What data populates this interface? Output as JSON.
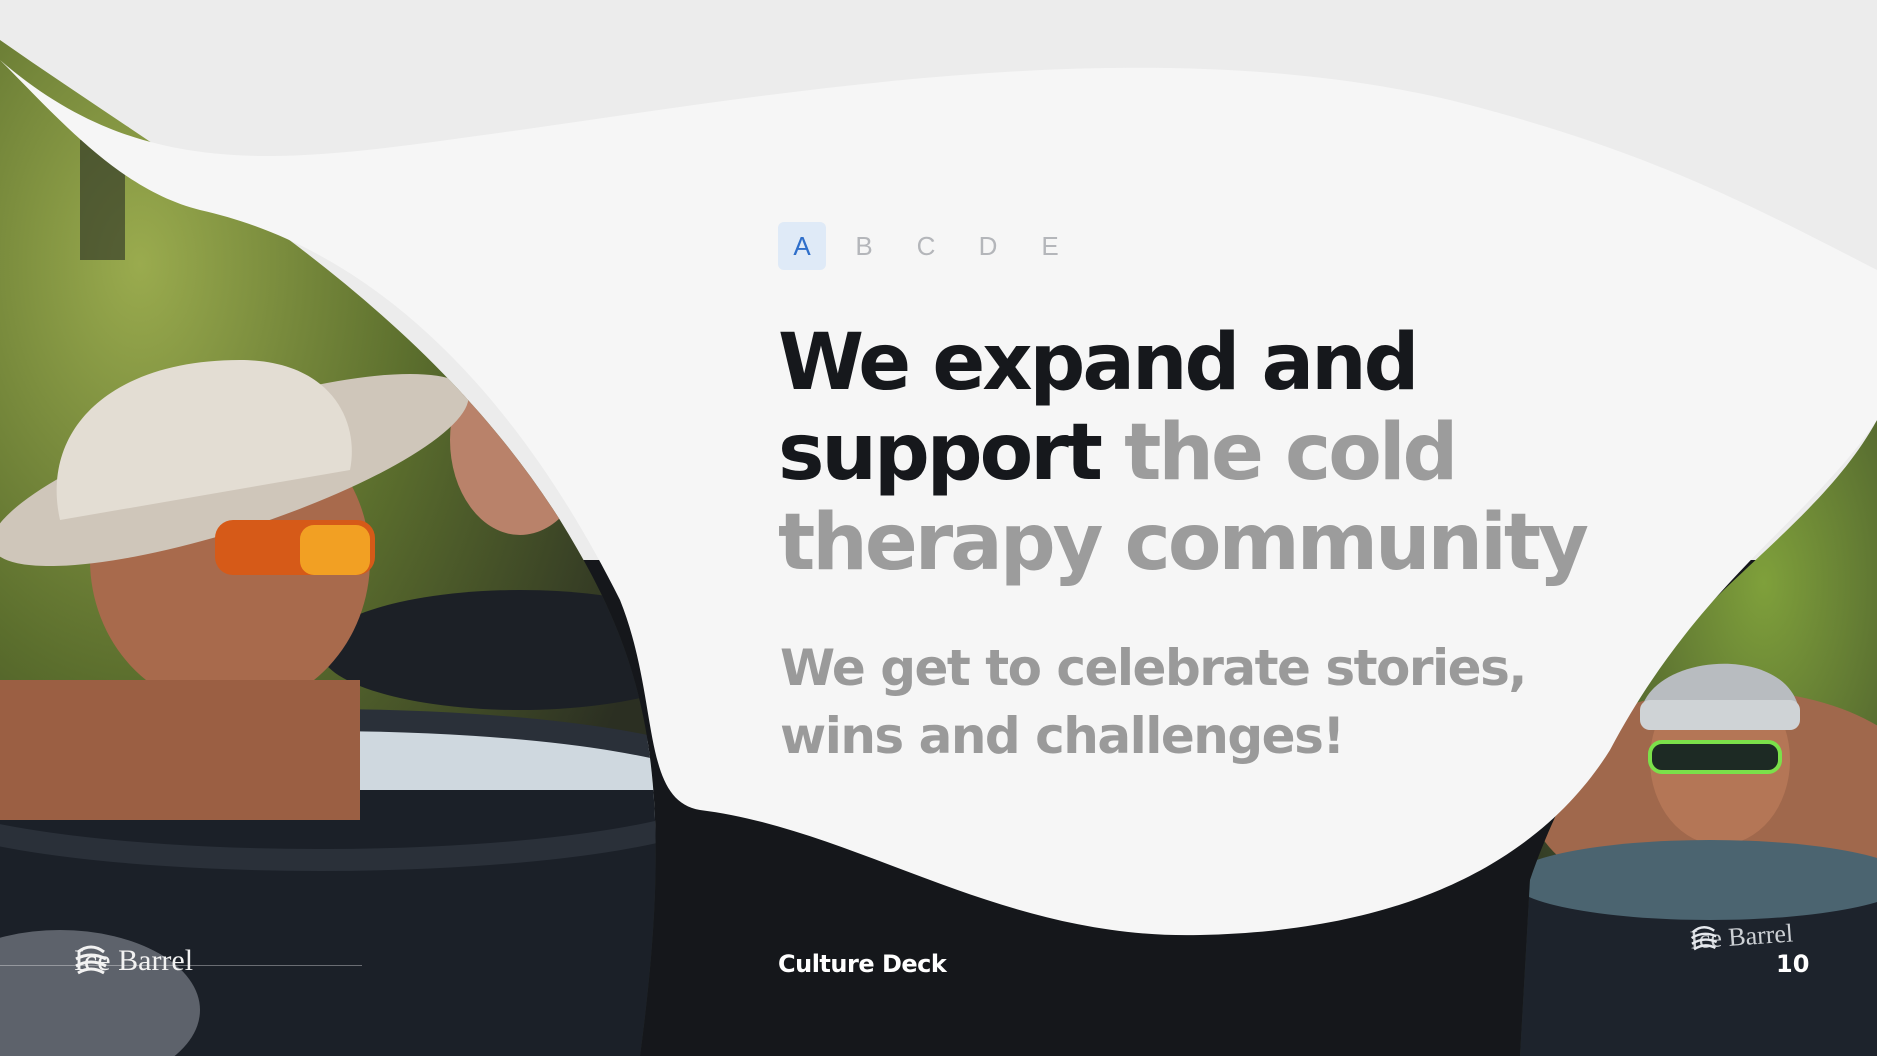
{
  "tabs": [
    {
      "label": "A",
      "active": true
    },
    {
      "label": "B",
      "active": false
    },
    {
      "label": "C",
      "active": false
    },
    {
      "label": "D",
      "active": false
    },
    {
      "label": "E",
      "active": false
    }
  ],
  "headline": {
    "part1": "We expand and support",
    "part2": "the cold therapy community"
  },
  "subhead": "We get to celebrate stories, wins and challenges!",
  "footer": {
    "brand": "Ice Barrel",
    "title": "Culture Deck",
    "page_number": "10"
  },
  "photo_right": {
    "barrel_brand": "Ice Barrel"
  },
  "colors": {
    "accent": "#2f6fca",
    "accent_bg": "#dfeaf7",
    "heading": "#16181c",
    "muted": "#9c9c9c",
    "background": "#f6f6f6",
    "dark": "#15171b"
  },
  "icons": [
    "ice-barrel-logo-icon"
  ]
}
